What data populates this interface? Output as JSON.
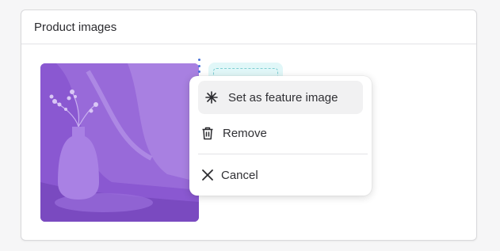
{
  "card": {
    "title": "Product images"
  },
  "colors": {
    "thumb_tint": "#8b5bd3",
    "accent": "#4a73d9",
    "dropzone": "#e1f7f8"
  },
  "menu": {
    "items": [
      {
        "label": "Set as feature image",
        "icon": "asterisk-icon"
      },
      {
        "label": "Remove",
        "icon": "trash-icon"
      },
      {
        "label": "Cancel",
        "icon": "close-icon"
      }
    ]
  }
}
